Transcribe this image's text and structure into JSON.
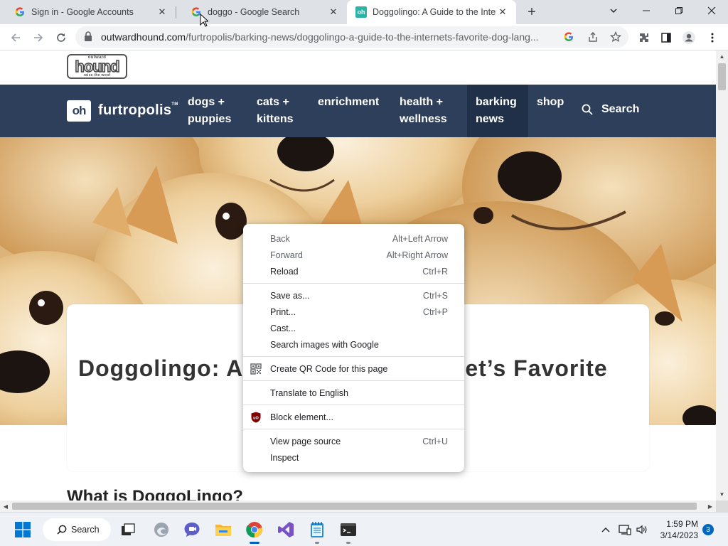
{
  "browser": {
    "tabs": [
      {
        "title": "Sign in - Google Accounts",
        "favicon": "google-g-icon",
        "active": false
      },
      {
        "title": "doggo - Google Search",
        "favicon": "google-g-icon",
        "active": false
      },
      {
        "title": "Doggolingo: A Guide to the Inter",
        "favicon": "oh-favicon",
        "active": true
      }
    ],
    "new_tab": "+",
    "url_host": "outwardhound.com",
    "url_path": "/furtropolis/barking-news/doggolingo-a-guide-to-the-internets-favorite-dog-lang..."
  },
  "site": {
    "brand_top_small": "outward",
    "brand_top_big": "hound",
    "brand_top_tagline": "raise the woof",
    "logo_mark": "oh",
    "logo_name": "furtropolis",
    "logo_tm": "TM",
    "nav": [
      {
        "line1": "dogs +",
        "line2": "puppies"
      },
      {
        "line1": "cats +",
        "line2": "kittens"
      },
      {
        "line1": "enrichment",
        "line2": ""
      },
      {
        "line1": "health +",
        "line2": "wellness"
      },
      {
        "line1": "barking",
        "line2": "news"
      },
      {
        "line1": "shop",
        "line2": ""
      }
    ],
    "search_label": "Search",
    "headline": "Doggolingo: A Guide to the Internet’s Favorite",
    "subheading": "What is DoggoLingo?"
  },
  "context_menu": {
    "items": [
      {
        "label": "Back",
        "shortcut": "Alt+Left Arrow"
      },
      {
        "label": "Forward",
        "shortcut": "Alt+Right Arrow"
      },
      {
        "label": "Reload",
        "shortcut": "Ctrl+R"
      },
      {
        "label": "Save as...",
        "shortcut": "Ctrl+S"
      },
      {
        "label": "Print...",
        "shortcut": "Ctrl+P"
      },
      {
        "label": "Cast...",
        "shortcut": ""
      },
      {
        "label": "Search images with Google",
        "shortcut": ""
      },
      {
        "label": "Create QR Code for this page",
        "shortcut": ""
      },
      {
        "label": "Translate to English",
        "shortcut": ""
      },
      {
        "label": "Block element...",
        "shortcut": ""
      },
      {
        "label": "View page source",
        "shortcut": "Ctrl+U"
      },
      {
        "label": "Inspect",
        "shortcut": ""
      }
    ]
  },
  "taskbar": {
    "search_label": "Search",
    "time": "1:59 PM",
    "date": "3/14/2023",
    "notification_count": "3"
  },
  "colors": {
    "site_nav_bg": "#2e3f5c",
    "site_nav_active_bg": "#203049",
    "tabstrip_bg": "#dee1e6",
    "taskbar_bg": "#eef1f6"
  }
}
